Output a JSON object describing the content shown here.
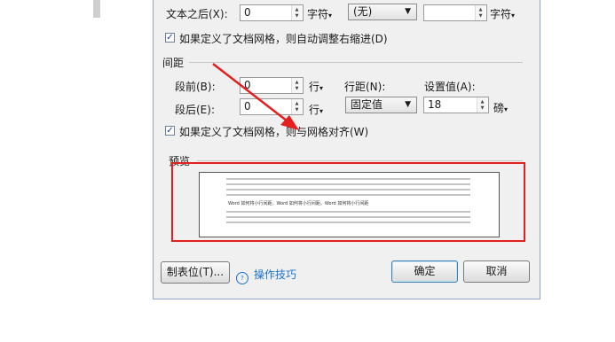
{
  "indent": {
    "after_text_label": "文本之后(X):",
    "after_text_value": "0",
    "after_text_unit": "字符",
    "special_value": "(无)",
    "special_unit": "字符",
    "auto_adjust_label": "如果定义了文档网格，则自动调整右缩进(D)",
    "auto_adjust_checked": "✓"
  },
  "spacing": {
    "title": "间距",
    "before_label": "段前(B):",
    "before_value": "0",
    "before_unit": "行",
    "after_label": "段后(E):",
    "after_value": "0",
    "after_unit": "行",
    "line_spacing_label": "行距(N):",
    "line_spacing_value": "固定值",
    "setting_label": "设置值(A):",
    "setting_value": "18",
    "setting_unit": "磅",
    "snap_label": "如果定义了文档网格，则与网格对齐(W)",
    "snap_checked": "✓"
  },
  "preview": {
    "title": "预览",
    "sample_text": "Word 如何将小行间距。Word 如何将小行间距。Word 如何将小行间距"
  },
  "buttons": {
    "tabs": "制表位(T)...",
    "tips": "操作技巧",
    "tips_icon_glyph": "?",
    "ok": "确定",
    "cancel": "取消"
  },
  "colors": {
    "annotation_red": "#e51e1e",
    "link_blue": "#1a73c9"
  }
}
